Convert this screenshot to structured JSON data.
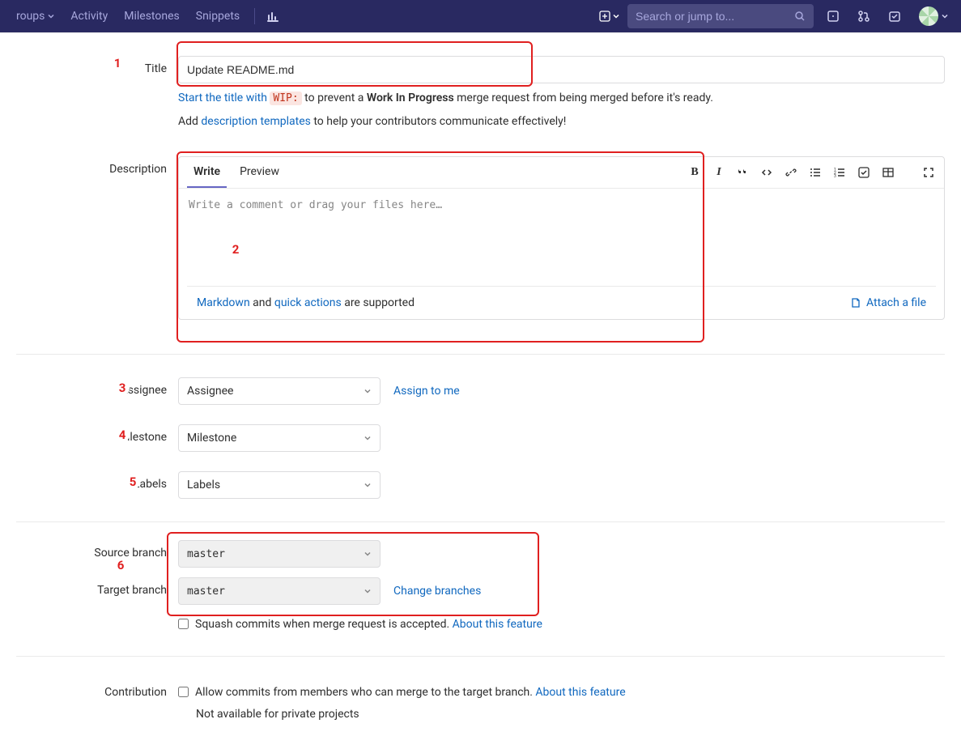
{
  "nav": {
    "groups": "roups",
    "activity": "Activity",
    "milestones": "Milestones",
    "snippets": "Snippets",
    "search_placeholder": "Search or jump to..."
  },
  "title_section": {
    "label": "Title",
    "value": "Update README.md",
    "hint_prefix": "Start the title with ",
    "wip": "WIP:",
    "hint_mid": " to prevent a ",
    "wip_bold": "Work In Progress",
    "hint_suffix": " merge request from being merged before it's ready.",
    "hint2_prefix": "Add ",
    "hint2_link": "description templates",
    "hint2_suffix": " to help your contributors communicate effectively!"
  },
  "desc_section": {
    "label": "Description",
    "tab_write": "Write",
    "tab_preview": "Preview",
    "placeholder": "Write a comment or drag your files here…",
    "markdown_link": "Markdown",
    "and": " and ",
    "quick_actions": "quick actions",
    "supported": " are supported",
    "attach": "Attach a file"
  },
  "assignee": {
    "label": "Assignee",
    "placeholder": "Assignee",
    "assign_me": "Assign to me"
  },
  "milestone": {
    "label": "Milestone",
    "placeholder": "Milestone"
  },
  "labels": {
    "label": "Labels",
    "placeholder": "Labels"
  },
  "branches": {
    "source_label": "Source branch",
    "source_value": "master",
    "target_label": "Target branch",
    "target_value": "master",
    "change_link": "Change branches",
    "squash_label": "Squash commits when merge request is accepted. ",
    "about_link": "About this feature"
  },
  "contribution": {
    "label": "Contribution",
    "allow_label": "Allow commits from members who can merge to the target branch. ",
    "about_link": "About this feature",
    "not_available": "Not available for private projects"
  },
  "markers": {
    "m1": "1",
    "m2": "2",
    "m3": "3",
    "m4": "4",
    "m5": "5",
    "m6": "6"
  }
}
